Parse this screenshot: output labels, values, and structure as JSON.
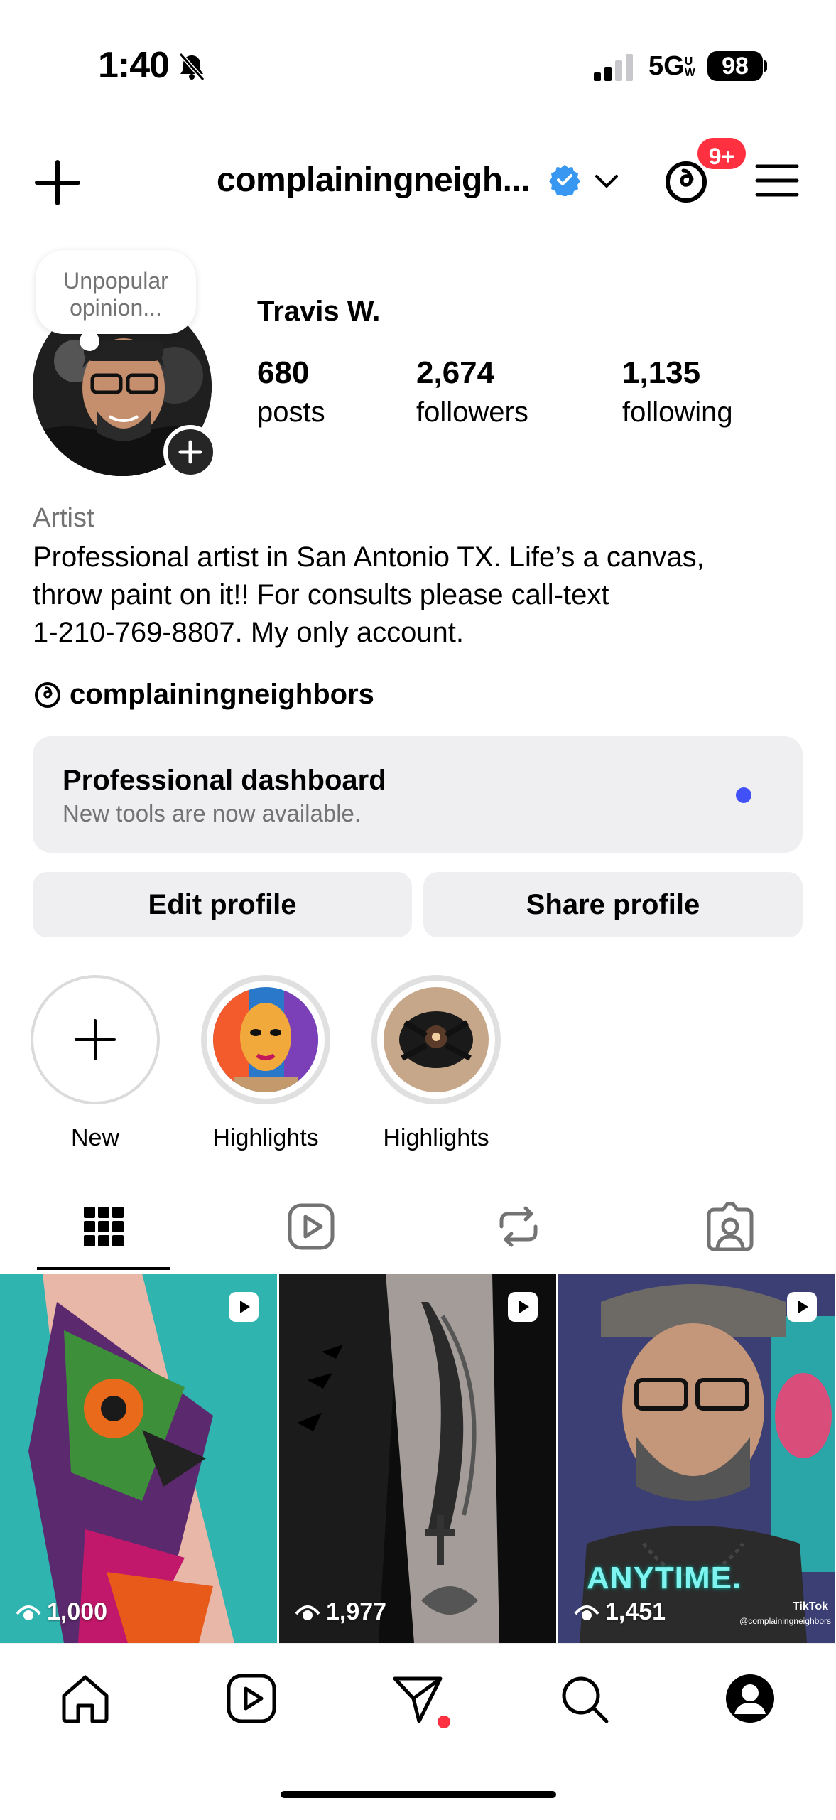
{
  "status": {
    "time": "1:40",
    "network": "5G",
    "network_sup": "UW",
    "battery": "98"
  },
  "header": {
    "username": "complainingneigh...",
    "notification_badge": "9+"
  },
  "profile": {
    "note": "Unpopular opinion...",
    "name": "Travis W.",
    "stats": [
      {
        "value": "680",
        "label": "posts"
      },
      {
        "value": "2,674",
        "label": "followers"
      },
      {
        "value": "1,135",
        "label": "following"
      }
    ],
    "category": "Artist",
    "bio_lines": [
      "Professional artist in San Antonio TX. Life’s a canvas,",
      "throw paint on it!! For consults please call-text",
      "1-210-769-8807. My only account."
    ],
    "threads_handle": "complainingneighbors"
  },
  "dashboard": {
    "title": "Professional dashboard",
    "subtitle": "New tools are now available."
  },
  "buttons": {
    "edit": "Edit profile",
    "share": "Share profile"
  },
  "highlights": [
    {
      "label": "New"
    },
    {
      "label": "Highlights"
    },
    {
      "label": "Highlights"
    }
  ],
  "tabs": [
    "grid-icon",
    "reels-icon",
    "reposts-icon",
    "tagged-icon"
  ],
  "posts": [
    {
      "views": "1,000"
    },
    {
      "views": "1,977"
    },
    {
      "views": "1,451",
      "overlay_text": "ANYTIME.",
      "watermark": "TikTok",
      "watermark_handle": "@complainingneighbors"
    }
  ],
  "colors": {
    "accent_blue": "#4150f7",
    "badge_red": "#ff3040",
    "verified_blue": "#3897f0",
    "button_bg": "#efeff2"
  }
}
